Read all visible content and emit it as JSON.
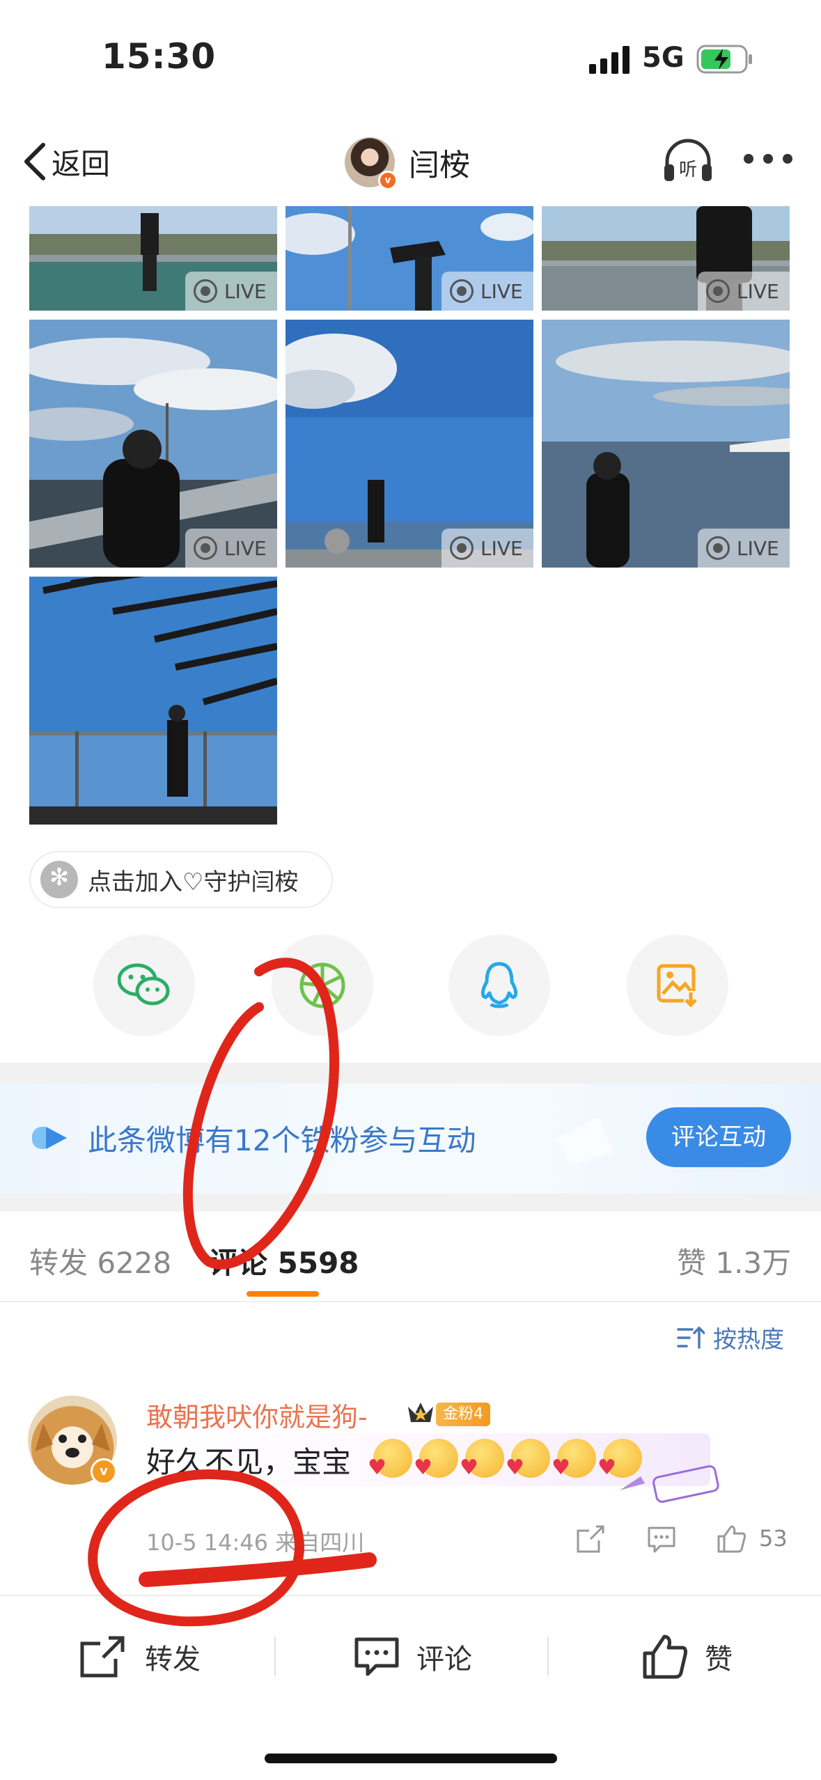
{
  "status_bar": {
    "time": "15:30",
    "network": "5G"
  },
  "nav": {
    "back_label": "返回",
    "title": "闫桉",
    "listen_label": "听"
  },
  "photos": [
    {
      "live": "LIVE"
    },
    {
      "live": "LIVE"
    },
    {
      "live": "LIVE"
    },
    {
      "live": "LIVE"
    },
    {
      "live": "LIVE"
    },
    {
      "live": "LIVE"
    },
    {
      "live": ""
    }
  ],
  "join": {
    "label": "点击加入♡守护闫桉"
  },
  "share": [
    "wechat-icon",
    "moments-icon",
    "qq-icon",
    "save-image-icon"
  ],
  "promo": {
    "text": "此条微博有12个铁粉参与互动",
    "button": "评论互动"
  },
  "tabs": {
    "repost": "转发 6228",
    "comments": "评论 5598",
    "likes": "赞 1.3万"
  },
  "sort": {
    "label": "按热度"
  },
  "comment": {
    "username": "敢朝我吠你就是狗-",
    "fan_badge": "金粉4",
    "text": "好久不见，宝宝",
    "emoji_count": 6,
    "meta": "10-5 14:46 来自四川",
    "likes": "53"
  },
  "bottom_bar": {
    "repost": "转发",
    "comment": "评论",
    "like": "赞"
  },
  "colors": {
    "accent": "#ff8200",
    "link": "#3a78c9",
    "annotation": "#e0261b"
  }
}
